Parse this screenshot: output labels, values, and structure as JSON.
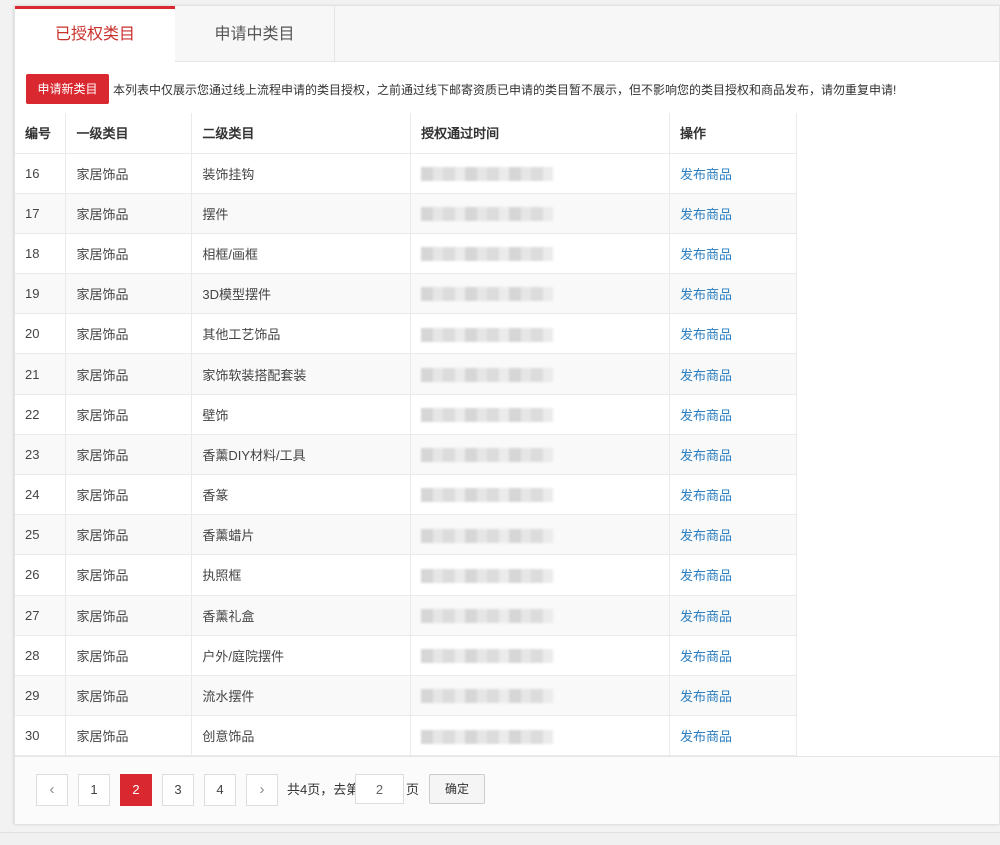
{
  "tabs": [
    {
      "label": "已授权类目"
    },
    {
      "label": "申请中类目"
    }
  ],
  "notice": {
    "button_label": "申请新类目",
    "text": "本列表中仅展示您通过线上流程申请的类目授权，之前通过线下邮寄资质已申请的类目暂不展示，但不影响您的类目授权和商品发布，请勿重复申请!"
  },
  "table": {
    "headers": [
      "编号",
      "一级类目",
      "二级类目",
      "授权通过时间",
      "操作"
    ],
    "rows": [
      {
        "id": "16",
        "level1": "家居饰品",
        "level2": "装饰挂钩",
        "action": "发布商品"
      },
      {
        "id": "17",
        "level1": "家居饰品",
        "level2": "摆件",
        "action": "发布商品"
      },
      {
        "id": "18",
        "level1": "家居饰品",
        "level2": "相框/画框",
        "action": "发布商品"
      },
      {
        "id": "19",
        "level1": "家居饰品",
        "level2": "3D模型摆件",
        "action": "发布商品"
      },
      {
        "id": "20",
        "level1": "家居饰品",
        "level2": "其他工艺饰品",
        "action": "发布商品"
      },
      {
        "id": "21",
        "level1": "家居饰品",
        "level2": "家饰软装搭配套装",
        "action": "发布商品"
      },
      {
        "id": "22",
        "level1": "家居饰品",
        "level2": "壁饰",
        "action": "发布商品"
      },
      {
        "id": "23",
        "level1": "家居饰品",
        "level2": "香薰DIY材料/工具",
        "action": "发布商品"
      },
      {
        "id": "24",
        "level1": "家居饰品",
        "level2": "香篆",
        "action": "发布商品"
      },
      {
        "id": "25",
        "level1": "家居饰品",
        "level2": "香薰蜡片",
        "action": "发布商品"
      },
      {
        "id": "26",
        "level1": "家居饰品",
        "level2": "执照框",
        "action": "发布商品"
      },
      {
        "id": "27",
        "level1": "家居饰品",
        "level2": "香薰礼盒",
        "action": "发布商品"
      },
      {
        "id": "28",
        "level1": "家居饰品",
        "level2": "户外/庭院摆件",
        "action": "发布商品"
      },
      {
        "id": "29",
        "level1": "家居饰品",
        "level2": "流水摆件",
        "action": "发布商品"
      },
      {
        "id": "30",
        "level1": "家居饰品",
        "level2": "创意饰品",
        "action": "发布商品"
      }
    ]
  },
  "pagination": {
    "prev": "‹",
    "next": "›",
    "pages": [
      "1",
      "2",
      "3",
      "4"
    ],
    "current": "2",
    "total_text": "共4页，去第",
    "input_value": "2",
    "page_suffix": "页",
    "confirm_label": "确定"
  },
  "colors": {
    "accent": "#d9282f",
    "link": "#2a7ec0"
  }
}
